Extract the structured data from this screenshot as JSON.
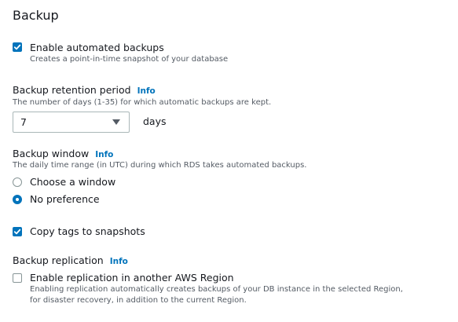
{
  "section": {
    "title": "Backup"
  },
  "automated_backups": {
    "label": "Enable automated backups",
    "description": "Creates a point-in-time snapshot of your database",
    "checked": true
  },
  "retention": {
    "label": "Backup retention period",
    "info": "Info",
    "description": "The number of days (1-35) for which automatic backups are kept.",
    "value": "7",
    "unit": "days"
  },
  "window": {
    "label": "Backup window",
    "info": "Info",
    "description": "The daily time range (in UTC) during which RDS takes automated backups.",
    "options": [
      {
        "label": "Choose a window",
        "selected": false
      },
      {
        "label": "No preference",
        "selected": true
      }
    ]
  },
  "copy_tags": {
    "label": "Copy tags to snapshots",
    "checked": true
  },
  "replication": {
    "label": "Backup replication",
    "info": "Info",
    "option_label": "Enable replication in another AWS Region",
    "option_description_1": "Enabling replication automatically creates backups of your DB instance in the selected Region,",
    "option_description_2": "for disaster recovery, in addition to the current Region.",
    "checked": false
  },
  "colors": {
    "accent": "#0073bb",
    "text": "#16191f",
    "muted": "#545b64",
    "border": "#879596"
  }
}
